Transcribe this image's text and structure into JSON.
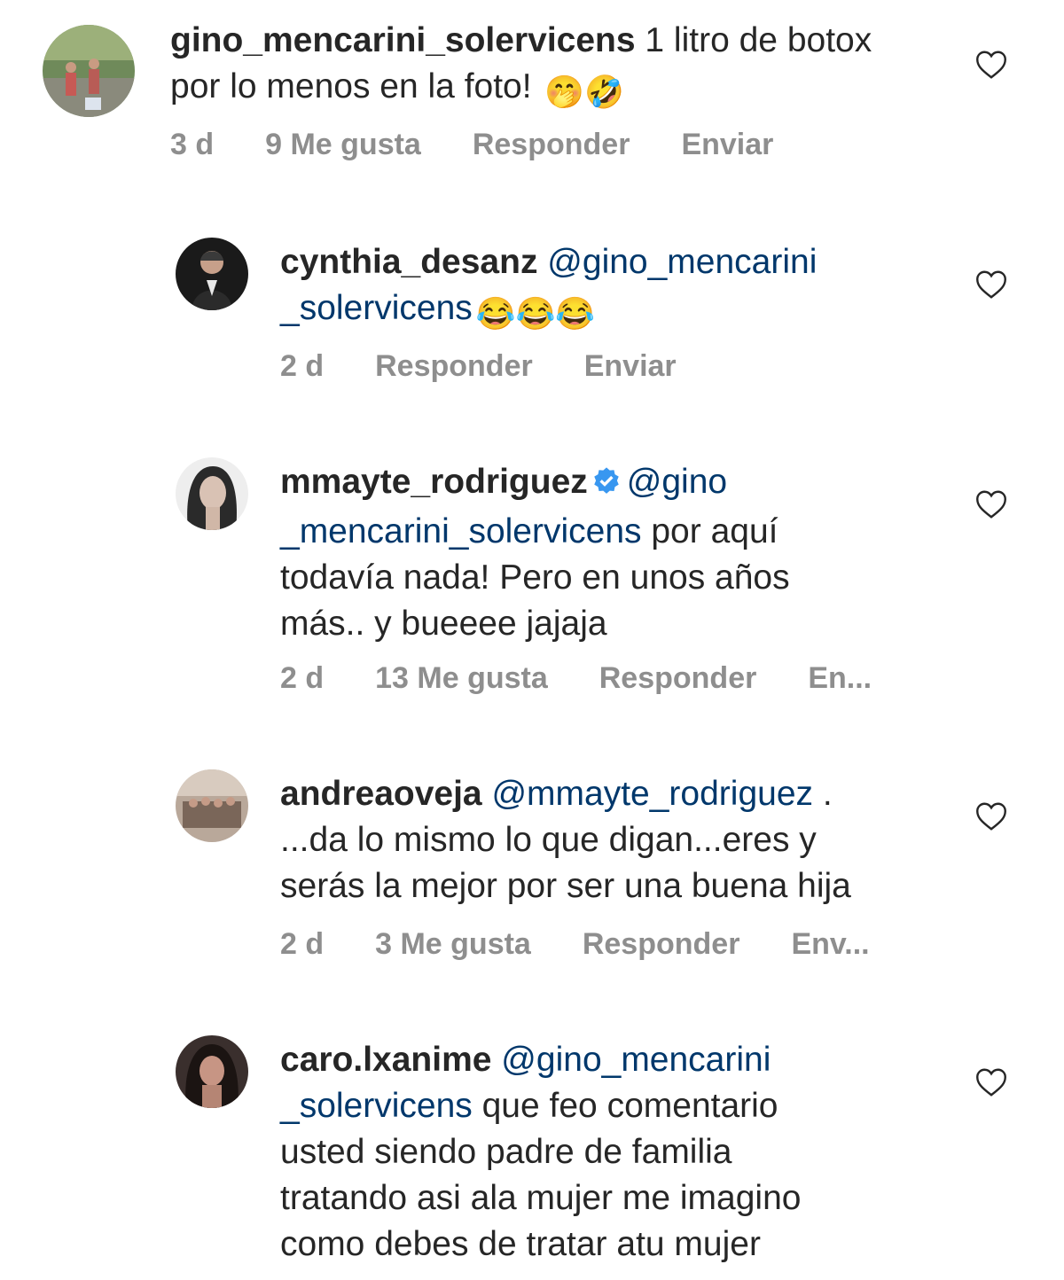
{
  "comments": [
    {
      "username": "gino_mencarini_solervicens",
      "mention": "",
      "text_line1": " 1 litro de botox",
      "text_line2": "por lo menos en la foto! ",
      "emoji": "🤭🤣",
      "time": "3 d",
      "likes": "9 Me gusta",
      "reply": "Responder",
      "send": "Enviar"
    },
    {
      "username": "cynthia_desanz",
      "mention_line1": " @gino_mencarini",
      "mention_line2": "_solervicens",
      "emoji": "😂😂😂",
      "time": "2 d",
      "reply": "Responder",
      "send": "Enviar"
    },
    {
      "username": "mmayte_rodriguez",
      "verified": true,
      "mention_line1": "@gino",
      "mention_line2": "_mencarini_solervicens",
      "text_line2": " por aquí",
      "text_line3": "todavía nada! Pero en unos años",
      "text_line4": "más.. y bueeee jajaja",
      "time": "2 d",
      "likes": "13 Me gusta",
      "reply": "Responder",
      "send": "En..."
    },
    {
      "username": "andreaoveja",
      "mention_line1": " @mmayte_rodriguez",
      "text_line1": " .",
      "text_line2": "...da lo mismo lo que digan...eres y",
      "text_line3": "serás la mejor por ser una buena hija",
      "time": "2 d",
      "likes": "3 Me gusta",
      "reply": "Responder",
      "send": "Env..."
    },
    {
      "username": "caro.lxanime",
      "mention_line1": " @gino_mencarini",
      "mention_line2": "_solervicens",
      "text_line2": " que feo comentario",
      "text_line3": "usted siendo padre de familia",
      "text_line4": "tratando asi ala mujer me imagino",
      "text_line5": "como debes de tratar atu mujer"
    }
  ],
  "colors": {
    "text": "#262626",
    "mention": "#00376b",
    "meta": "#8e8e8e",
    "verified": "#3897f0"
  },
  "icons": [
    "heart-outline-icon",
    "verified-badge-icon"
  ]
}
